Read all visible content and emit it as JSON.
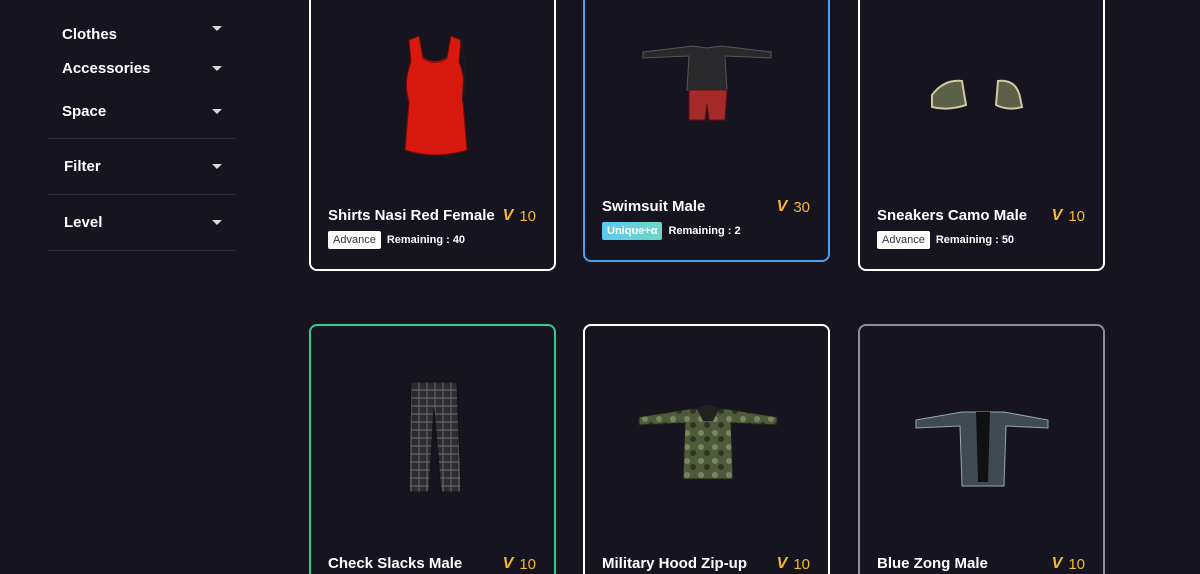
{
  "sidebar": {
    "categories": [
      {
        "label": "Clothes"
      },
      {
        "label": "Accessories"
      },
      {
        "label": "Space"
      }
    ],
    "sections": [
      {
        "label": "Filter"
      },
      {
        "label": "Level"
      }
    ]
  },
  "items": [
    {
      "name": "Shirts Nasi Red Female",
      "price": "10",
      "badge": "Advance",
      "remaining": "Remaining : 40"
    },
    {
      "name": "Swimsuit Male",
      "price": "30",
      "badge": "Unique+α",
      "remaining": "Remaining : 2"
    },
    {
      "name": "Sneakers Camo Male",
      "price": "10",
      "badge": "Advance",
      "remaining": "Remaining : 50"
    },
    {
      "name": "Check Slacks Male",
      "price": "10"
    },
    {
      "name": "Military Hood Zip-up",
      "price": "10"
    },
    {
      "name": "Blue Zong Male",
      "price": "10"
    }
  ],
  "colors": {
    "background": "#16151f",
    "price": "#f5b82e",
    "border_unique": "#4aa3e8",
    "border_green": "#2ecc8a",
    "border_grey": "#8e8d96"
  }
}
